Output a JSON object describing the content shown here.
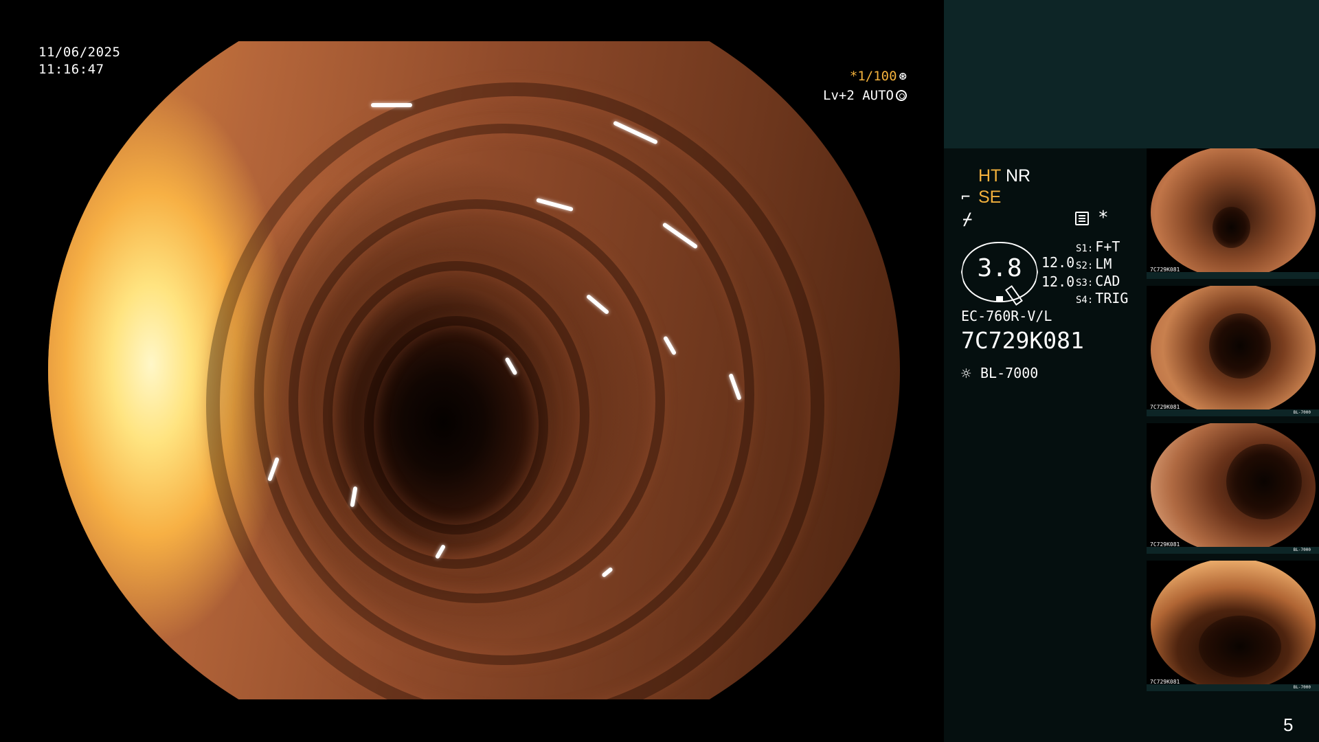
{
  "overlay": {
    "date": "11/06/2025",
    "time": "11:16:47",
    "shutter": "*1/100",
    "level": "Lv+2 AUTO"
  },
  "panel": {
    "ht": "HT",
    "nr": "NR",
    "se": "SE",
    "hex_value": "3.8",
    "value1": "12.0",
    "value2": "12.0",
    "slots": [
      {
        "key": "S1:",
        "label": "F+T"
      },
      {
        "key": "S2:",
        "label": "LM"
      },
      {
        "key": "S3:",
        "label": "CAD"
      },
      {
        "key": "S4:",
        "label": "TRIG"
      }
    ],
    "model": "EC-760R-V/L",
    "serial": "7C729K081",
    "light_source": "BL-7000",
    "page_number": "5"
  },
  "thumbnails": {
    "serial": "7C729K081",
    "light_source": "BL-7000"
  },
  "icons": {
    "shutter": "aperture-icon",
    "level": "iris-icon",
    "se": "structure-enhance-icon",
    "freeze": "freeze-icon",
    "menu": "menu-icon",
    "star": "star-icon",
    "light": "sun-icon"
  },
  "colors": {
    "accent": "#f3b13c",
    "panel_top": "#0d2526",
    "panel": "#050f0f"
  }
}
